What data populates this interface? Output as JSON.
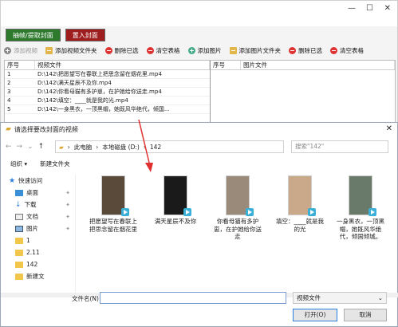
{
  "app": {
    "tabs": [
      "抽帧/提取封面",
      "置入封面"
    ],
    "toolbar": [
      "添加视频",
      "添加视频文件夹",
      "删除已选",
      "清空表格",
      "添加图片",
      "添加图片文件夹",
      "删除已选",
      "清空表格"
    ],
    "left_headers": [
      "序号",
      "视频文件"
    ],
    "right_headers": [
      "序号",
      "图片文件"
    ],
    "rows": [
      {
        "n": "1",
        "file": "D:\\142\\把愿望写在春联上把思念留在烟花里.mp4"
      },
      {
        "n": "2",
        "file": "D:\\142\\满天星辰不及你.mp4"
      },
      {
        "n": "3",
        "file": "D:\\142\\你看母猫有多护崽，在护她给你送走.mp4"
      },
      {
        "n": "4",
        "file": "D:\\142\\填空：____就是我的光.mp4"
      },
      {
        "n": "5",
        "file": "D:\\142\\一身黑衣，一顶黑帽，她既风华绝代，倾国..."
      }
    ],
    "colors": {
      "tab_green": "#2d7a2d",
      "tab_red": "#a01d1d",
      "arrow": "#e03030",
      "play_badge": "#3bb0d6"
    }
  },
  "dialog": {
    "title": "请选择要改封面的视频",
    "path": [
      "此电脑",
      "本地磁盘 (D:)",
      "142"
    ],
    "search_placeholder": "搜索\"142\"",
    "cmd": [
      "组织 ▾",
      "新建文件夹"
    ],
    "sidebar": [
      {
        "label": "快速访问",
        "icon": "star-icon",
        "top": true
      },
      {
        "label": "桌面",
        "icon": "desktop-icon",
        "pin": true
      },
      {
        "label": "下载",
        "icon": "download-icon",
        "pin": true
      },
      {
        "label": "文档",
        "icon": "document-icon",
        "pin": true
      },
      {
        "label": "图片",
        "icon": "picture-icon",
        "pin": true
      },
      {
        "label": "1",
        "icon": "folder-icon"
      },
      {
        "label": "2.11",
        "icon": "folder-icon"
      },
      {
        "label": "142",
        "icon": "folder-icon"
      },
      {
        "label": "新建文",
        "icon": "folder-icon"
      }
    ],
    "files": [
      {
        "name": "把愿望写在春联上把思念留在烟花里",
        "thumb": "#5a4a3a"
      },
      {
        "name": "满天星辰不及你",
        "thumb": "#1a1a1a"
      },
      {
        "name": "你看母猫有多护崽，在护她给你送走",
        "thumb": "#9a8a7a"
      },
      {
        "name": "填空：____就是我的光",
        "thumb": "#c9a98a"
      },
      {
        "name": "一身黑衣，一顶黑帽，她既风华绝代，倾国倾城。",
        "thumb": "#6a7a6a"
      }
    ],
    "filename_label": "文件名(N):",
    "filetype": "视频文件",
    "open": "打开(O)",
    "cancel": "取消"
  }
}
